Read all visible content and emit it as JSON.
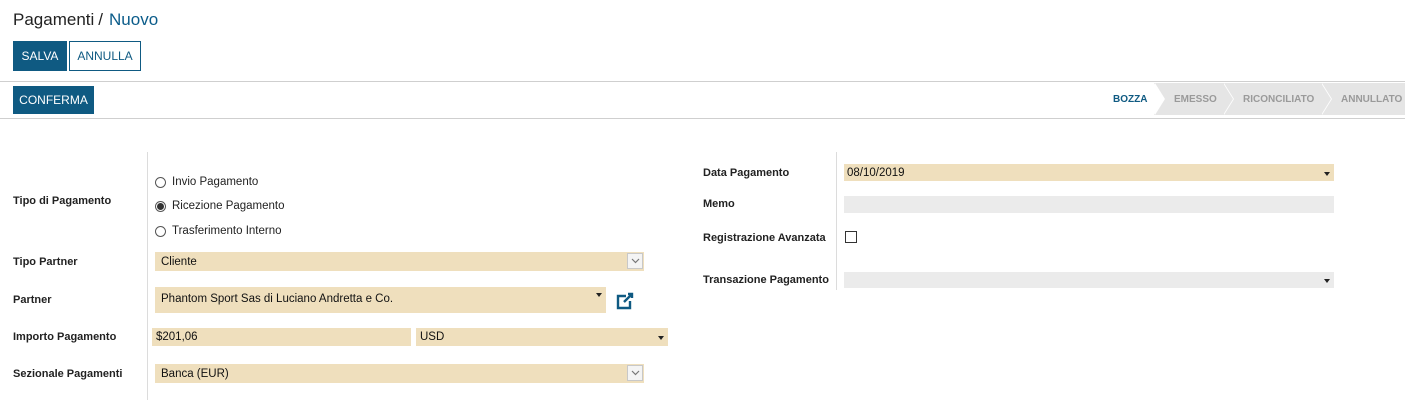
{
  "breadcrumb": {
    "parent": "Pagamenti",
    "separator": "/",
    "current": "Nuovo"
  },
  "toolbar": {
    "save_label": "SALVA",
    "discard_label": "ANNULLA"
  },
  "header": {
    "confirm_label": "CONFERMA"
  },
  "statusbar": {
    "steps": [
      "BOZZA",
      "EMESSO",
      "RICONCILIATO",
      "ANNULLATO"
    ],
    "active": "BOZZA"
  },
  "form": {
    "payment_type": {
      "label": "Tipo di Pagamento",
      "options": [
        "Invio Pagamento",
        "Ricezione Pagamento",
        "Trasferimento Interno"
      ],
      "selected": "Ricezione Pagamento"
    },
    "partner_type": {
      "label": "Tipo Partner",
      "value": "Cliente"
    },
    "partner": {
      "label": "Partner",
      "value": "Phantom Sport Sas di Luciano Andretta e Co."
    },
    "amount": {
      "label": "Importo Pagamento",
      "value": "$201,06",
      "currency": "USD"
    },
    "journal": {
      "label": "Sezionale Pagamenti",
      "value": "Banca (EUR)"
    },
    "payment_date": {
      "label": "Data Pagamento",
      "value": "08/10/2019"
    },
    "memo": {
      "label": "Memo",
      "value": ""
    },
    "advanced_registration": {
      "label": "Registrazione Avanzata",
      "checked": false
    },
    "payment_transaction": {
      "label": "Transazione Pagamento",
      "value": ""
    }
  },
  "colors": {
    "primary": "#0f5a82",
    "required_field": "#efdfbd",
    "readonly_field": "#ebebeb"
  },
  "icons": {
    "external_link": "external-link-icon",
    "dropdown": "caret-down-icon",
    "chevron": "chevron-down-icon"
  }
}
